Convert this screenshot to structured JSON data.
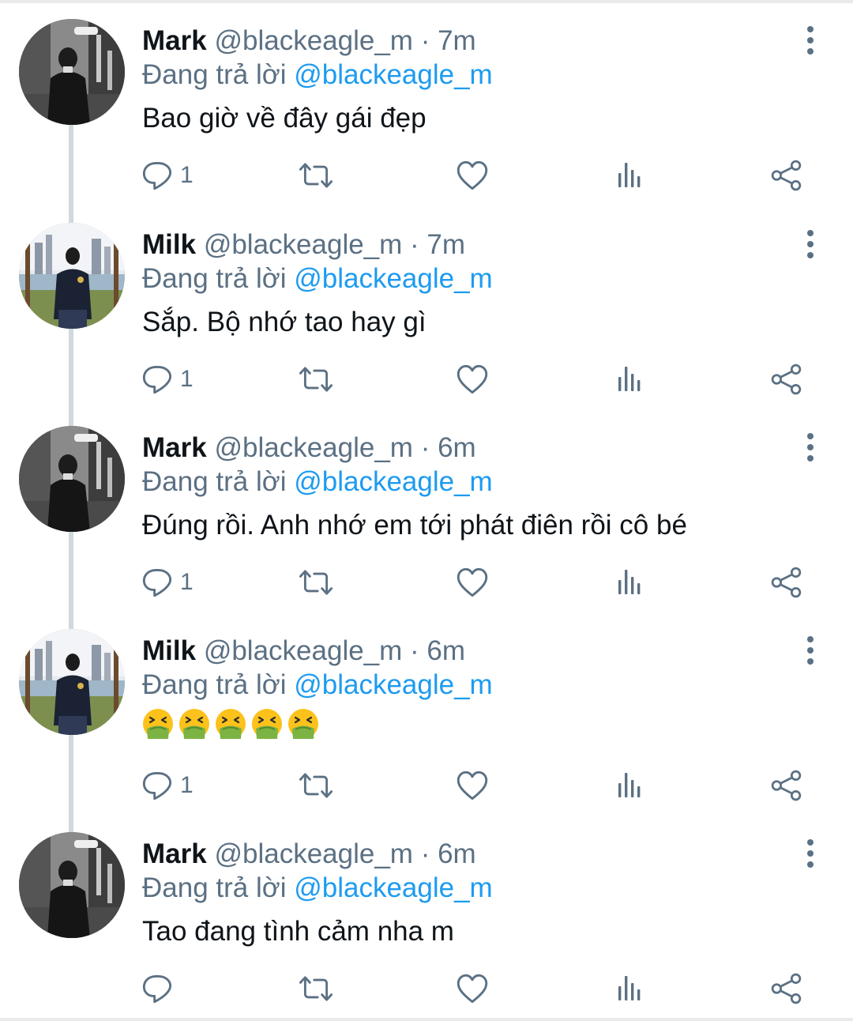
{
  "thread": {
    "reply_prefix": "Đang trả lời",
    "tweets": [
      {
        "name": "Mark",
        "handle": "@blackeagle_m",
        "time": "· 7m",
        "reply_to": "@blackeagle_m",
        "text": "Bao giờ về đây gái đẹp",
        "reply_count": "1",
        "avatar": "mark-avatar"
      },
      {
        "name": "Milk",
        "handle": "@blackeagle_m",
        "time": "· 7m",
        "reply_to": "@blackeagle_m",
        "text": "Sắp. Bộ nhớ tao hay gì",
        "reply_count": "1",
        "avatar": "milk-avatar"
      },
      {
        "name": "Mark",
        "handle": "@blackeagle_m",
        "time": "· 6m",
        "reply_to": "@blackeagle_m",
        "text": "Đúng rồi. Anh nhớ em tới phát điên rồi cô bé",
        "reply_count": "1",
        "avatar": "mark-avatar"
      },
      {
        "name": "Milk",
        "handle": "@blackeagle_m",
        "time": "· 6m",
        "reply_to": "@blackeagle_m",
        "text": "",
        "emojis": [
          "vomiting-face-emoji",
          "vomiting-face-emoji",
          "vomiting-face-emoji",
          "vomiting-face-emoji",
          "vomiting-face-emoji"
        ],
        "reply_count": "1",
        "avatar": "milk-avatar"
      },
      {
        "name": "Mark",
        "handle": "@blackeagle_m",
        "time": "· 6m",
        "reply_to": "@blackeagle_m",
        "text": "Tao đang tình cảm nha m",
        "reply_count": "",
        "avatar": "mark-avatar"
      }
    ]
  },
  "colors": {
    "link": "#1d9bf0",
    "secondary_text": "#5b7083",
    "primary_text": "#0f1419",
    "thread_line": "#cfd9de"
  },
  "icons": [
    "reply-icon",
    "retweet-icon",
    "like-icon",
    "analytics-icon",
    "share-icon",
    "more-options-icon"
  ]
}
